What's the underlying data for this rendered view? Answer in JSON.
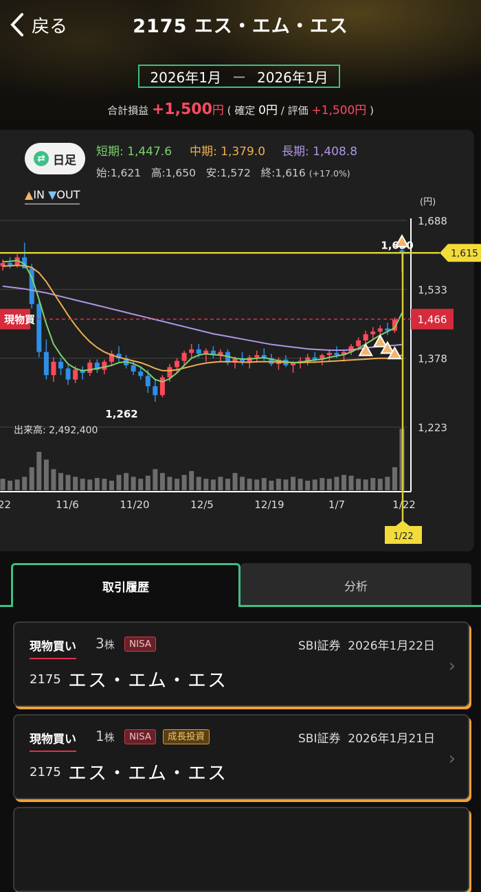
{
  "header": {
    "back_label": "戻る",
    "title": "2175 エス・エム・エス",
    "range_start": "2026年1月",
    "range_sep": "ー",
    "range_end": "2026年1月",
    "pnl_label": "合計損益",
    "pnl_value": "+1,500",
    "pnl_unit": "円",
    "realized_label": "確定",
    "realized_value": "0",
    "realized_unit": "円",
    "eval_label": "評価",
    "eval_value": "+1,500",
    "eval_unit": "円"
  },
  "chart_panel": {
    "period_button": "日足",
    "ma_short_label": "短期:",
    "ma_short_value": "1,447.6",
    "ma_mid_label": "中期:",
    "ma_mid_value": "1,379.0",
    "ma_long_label": "長期:",
    "ma_long_value": "1,408.8",
    "open_label": "始:",
    "open_value": "1,621",
    "high_label": "高:",
    "high_value": "1,650",
    "low_label": "安:",
    "low_value": "1,572",
    "close_label": "終:",
    "close_value": "1,616",
    "change_pct": "(+17.0%)",
    "legend_in": "IN",
    "legend_out": "OUT",
    "colors": {
      "ma_short": "#7ed26a",
      "ma_mid": "#f0b050",
      "ma_long": "#b096e6",
      "up": "#ff4a5c",
      "down": "#2f8fe8",
      "accent": "#3fbf86",
      "marker": "#d8d03a"
    }
  },
  "chart_data": {
    "type": "candlestick",
    "unit_label": "(円)",
    "y_ticks": [
      1688,
      1533,
      1378,
      1223
    ],
    "ylim": [
      1223,
      1688
    ],
    "x_tick_labels": [
      "/22",
      "11/6",
      "11/20",
      "12/5",
      "12/19",
      "1/7",
      "1/22"
    ],
    "labels": {
      "high_point": "1,650",
      "low_point": "1,262",
      "current_price": "1,615",
      "position_price": "1,466",
      "position_label": "現物買",
      "selected_date": "1/22",
      "volume": "出来高: 2,492,400"
    },
    "candles": [
      [
        1585,
        1600,
        1575,
        1592
      ],
      [
        1592,
        1605,
        1580,
        1588
      ],
      [
        1588,
        1612,
        1582,
        1605
      ],
      [
        1605,
        1638,
        1595,
        1580
      ],
      [
        1580,
        1590,
        1490,
        1500
      ],
      [
        1500,
        1510,
        1380,
        1392
      ],
      [
        1392,
        1420,
        1330,
        1340
      ],
      [
        1340,
        1380,
        1325,
        1370
      ],
      [
        1370,
        1378,
        1340,
        1355
      ],
      [
        1355,
        1362,
        1318,
        1330
      ],
      [
        1330,
        1360,
        1322,
        1352
      ],
      [
        1352,
        1360,
        1330,
        1345
      ],
      [
        1345,
        1375,
        1338,
        1368
      ],
      [
        1368,
        1375,
        1345,
        1352
      ],
      [
        1352,
        1375,
        1342,
        1370
      ],
      [
        1370,
        1395,
        1360,
        1388
      ],
      [
        1388,
        1405,
        1370,
        1378
      ],
      [
        1378,
        1385,
        1355,
        1362
      ],
      [
        1362,
        1370,
        1340,
        1348
      ],
      [
        1348,
        1360,
        1330,
        1338
      ],
      [
        1338,
        1352,
        1300,
        1315
      ],
      [
        1315,
        1330,
        1280,
        1295
      ],
      [
        1295,
        1340,
        1290,
        1335
      ],
      [
        1335,
        1365,
        1325,
        1358
      ],
      [
        1358,
        1378,
        1345,
        1372
      ],
      [
        1372,
        1395,
        1362,
        1390
      ],
      [
        1390,
        1410,
        1378,
        1398
      ],
      [
        1398,
        1410,
        1380,
        1388
      ],
      [
        1388,
        1400,
        1370,
        1395
      ],
      [
        1395,
        1405,
        1378,
        1385
      ],
      [
        1385,
        1398,
        1370,
        1392
      ],
      [
        1392,
        1398,
        1362,
        1368
      ],
      [
        1368,
        1382,
        1355,
        1378
      ],
      [
        1378,
        1392,
        1362,
        1370
      ],
      [
        1370,
        1385,
        1355,
        1380
      ],
      [
        1380,
        1395,
        1368,
        1385
      ],
      [
        1385,
        1400,
        1372,
        1378
      ],
      [
        1378,
        1388,
        1360,
        1365
      ],
      [
        1365,
        1380,
        1352,
        1375
      ],
      [
        1375,
        1385,
        1358,
        1362
      ],
      [
        1362,
        1372,
        1345,
        1368
      ],
      [
        1368,
        1380,
        1355,
        1372
      ],
      [
        1372,
        1388,
        1362,
        1380
      ],
      [
        1380,
        1392,
        1368,
        1375
      ],
      [
        1375,
        1388,
        1362,
        1385
      ],
      [
        1385,
        1398,
        1372,
        1390
      ],
      [
        1390,
        1405,
        1378,
        1385
      ],
      [
        1385,
        1398,
        1370,
        1392
      ],
      [
        1392,
        1410,
        1385,
        1405
      ],
      [
        1405,
        1425,
        1395,
        1418
      ],
      [
        1418,
        1440,
        1408,
        1432
      ],
      [
        1432,
        1448,
        1420,
        1438
      ],
      [
        1438,
        1452,
        1425,
        1445
      ],
      [
        1445,
        1458,
        1430,
        1440
      ],
      [
        1440,
        1470,
        1435,
        1465
      ],
      [
        1621,
        1650,
        1572,
        1616
      ]
    ],
    "ma_short": [
      1595,
      1596,
      1598,
      1590,
      1560,
      1510,
      1455,
      1410,
      1385,
      1365,
      1355,
      1350,
      1352,
      1355,
      1358,
      1362,
      1368,
      1370,
      1366,
      1358,
      1345,
      1330,
      1325,
      1332,
      1345,
      1362,
      1378,
      1385,
      1388,
      1386,
      1385,
      1382,
      1378,
      1376,
      1376,
      1378,
      1379,
      1376,
      1372,
      1370,
      1368,
      1369,
      1372,
      1374,
      1376,
      1380,
      1383,
      1386,
      1392,
      1400,
      1410,
      1420,
      1430,
      1438,
      1446,
      1480
    ],
    "ma_mid": [
      1585,
      1586,
      1587,
      1586,
      1582,
      1570,
      1550,
      1525,
      1500,
      1475,
      1452,
      1432,
      1415,
      1402,
      1392,
      1385,
      1380,
      1376,
      1372,
      1368,
      1362,
      1355,
      1350,
      1350,
      1352,
      1356,
      1360,
      1364,
      1367,
      1369,
      1370,
      1370,
      1370,
      1369,
      1369,
      1370,
      1370,
      1370,
      1369,
      1369,
      1368,
      1368,
      1369,
      1369,
      1370,
      1371,
      1372,
      1373,
      1374,
      1375,
      1376,
      1377,
      1378,
      1378,
      1379,
      1385
    ],
    "ma_long": [
      1540,
      1538,
      1536,
      1534,
      1531,
      1528,
      1525,
      1521,
      1517,
      1513,
      1509,
      1505,
      1501,
      1497,
      1493,
      1489,
      1485,
      1481,
      1477,
      1473,
      1469,
      1465,
      1461,
      1457,
      1453,
      1449,
      1445,
      1441,
      1437,
      1433,
      1430,
      1427,
      1424,
      1421,
      1418,
      1415,
      1412,
      1409,
      1407,
      1405,
      1403,
      1401,
      1399,
      1398,
      1397,
      1396,
      1396,
      1396,
      1397,
      1399,
      1401,
      1403,
      1405,
      1406,
      1407,
      1408.8
    ],
    "volumes": [
      0.3,
      0.25,
      0.28,
      0.35,
      0.6,
      1.0,
      0.8,
      0.55,
      0.45,
      0.4,
      0.35,
      0.3,
      0.28,
      0.32,
      0.3,
      0.25,
      0.4,
      0.45,
      0.35,
      0.3,
      0.38,
      0.55,
      0.45,
      0.35,
      0.3,
      0.4,
      0.5,
      0.35,
      0.3,
      0.28,
      0.35,
      0.3,
      0.45,
      0.35,
      0.3,
      0.28,
      0.32,
      0.25,
      0.3,
      0.28,
      0.35,
      0.3,
      0.25,
      0.28,
      0.32,
      0.3,
      0.35,
      0.4,
      0.38,
      0.3,
      0.28,
      0.32,
      0.3,
      0.35,
      0.6,
      1.6
    ],
    "in_markers": [
      [
        50,
        1395
      ],
      [
        52,
        1415
      ],
      [
        53,
        1400
      ],
      [
        54,
        1388
      ],
      [
        55,
        1640
      ]
    ]
  },
  "tabs": [
    {
      "label": "取引履歴",
      "active": true
    },
    {
      "label": "分析",
      "active": false
    }
  ],
  "trades": [
    {
      "type": "現物買い",
      "qty": "3",
      "qty_unit": "株",
      "badges": [
        "NISA"
      ],
      "broker": "SBI証券",
      "date": "2026年1月22日",
      "code": "2175",
      "name": "エス・エム・エス"
    },
    {
      "type": "現物買い",
      "qty": "1",
      "qty_unit": "株",
      "badges": [
        "NISA",
        "成長投資"
      ],
      "broker": "SBI証券",
      "date": "2026年1月21日",
      "code": "2175",
      "name": "エス・エム・エス"
    }
  ]
}
